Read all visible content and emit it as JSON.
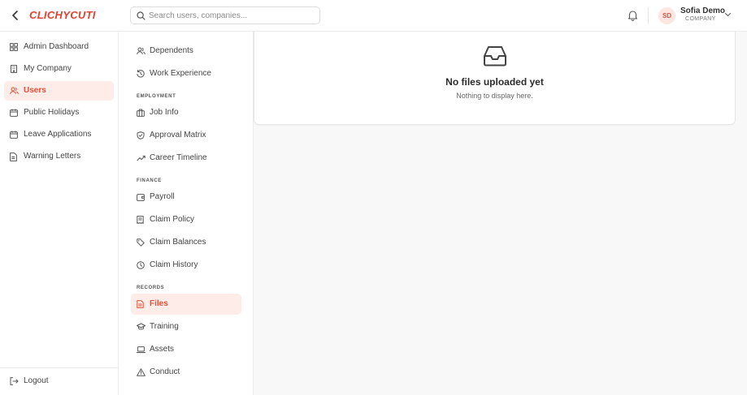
{
  "header": {
    "logo": "CLICHYCUTI",
    "search_placeholder": "Search users, companies...",
    "user": {
      "initials": "SD",
      "name": "Sofia Demo",
      "role": "COMPANY"
    }
  },
  "sidebar": {
    "items": [
      {
        "label": "Admin Dashboard",
        "icon": "dashboard-icon"
      },
      {
        "label": "My Company",
        "icon": "building-icon"
      },
      {
        "label": "Users",
        "icon": "users-icon",
        "active": true
      },
      {
        "label": "Public Holidays",
        "icon": "calendar-icon"
      },
      {
        "label": "Leave Applications",
        "icon": "calendar-icon"
      },
      {
        "label": "Warning Letters",
        "icon": "document-icon"
      }
    ],
    "logout_label": "Logout"
  },
  "subnav": {
    "profile_items": [
      {
        "label": "Dependents",
        "icon": "users-icon"
      },
      {
        "label": "Work Experience",
        "icon": "history-icon"
      }
    ],
    "sections": [
      {
        "title": "EMPLOYMENT",
        "items": [
          {
            "label": "Job Info",
            "icon": "briefcase-icon"
          },
          {
            "label": "Approval Matrix",
            "icon": "shield-check-icon"
          },
          {
            "label": "Career Timeline",
            "icon": "trending-up-icon"
          }
        ]
      },
      {
        "title": "FINANCE",
        "items": [
          {
            "label": "Payroll",
            "icon": "wallet-icon"
          },
          {
            "label": "Claim Policy",
            "icon": "receipt-icon"
          },
          {
            "label": "Claim Balances",
            "icon": "tag-icon"
          },
          {
            "label": "Claim History",
            "icon": "clock-icon"
          }
        ]
      },
      {
        "title": "RECORDS",
        "items": [
          {
            "label": "Files",
            "icon": "file-icon",
            "active": true
          },
          {
            "label": "Training",
            "icon": "graduation-cap-icon"
          },
          {
            "label": "Assets",
            "icon": "laptop-icon"
          },
          {
            "label": "Conduct",
            "icon": "alert-triangle-icon"
          }
        ]
      }
    ]
  },
  "main": {
    "empty_title": "No files uploaded yet",
    "empty_subtitle": "Nothing to display here."
  },
  "colors": {
    "accent": "#e0503a",
    "active_bg": "#fdece7"
  }
}
